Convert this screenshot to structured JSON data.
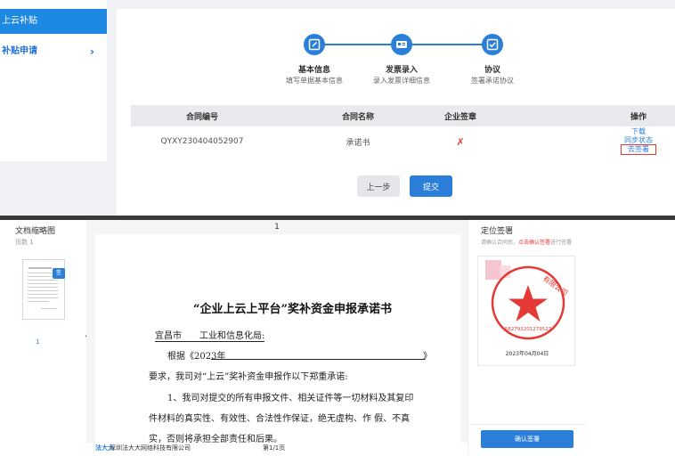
{
  "sidebar": {
    "active_item": "上云补贴",
    "item2": "补贴申请"
  },
  "steps": [
    {
      "title": "基本信息",
      "subtitle": "填写单据基本信息"
    },
    {
      "title": "发票录入",
      "subtitle": "录入发票详细信息"
    },
    {
      "title": "协议",
      "subtitle": "签署承诺协议"
    }
  ],
  "table": {
    "headers": [
      "合同编号",
      "合同名称",
      "企业签章",
      "操作"
    ],
    "row": {
      "contract_no": "QYXY230404052907",
      "contract_name": "承诺书",
      "seal_status": "✗",
      "actions": [
        "下载",
        "同步状态",
        "去签署"
      ]
    }
  },
  "buttons": {
    "prev": "上一步",
    "submit": "提交"
  },
  "viewer": {
    "left_title": "文档缩略图",
    "page_count": "页数 1",
    "thumb_badge": "签",
    "thumb_page": "1",
    "current_page": "1",
    "doc_title": "“企业上云上平台”奖补资金申报承诺书",
    "lines": [
      "宜昌市　　工业和信息化局:",
      "根据《2023年",
      "》",
      "要求，我司对“上云”奖补资金申报作以下郑重承诺:",
      "1、我司对提交的所有申报文件、相关证件等一切材料及其复印",
      "件材料的真实性、有效性、合法性作保证，绝无虚构、作 假、不真",
      "实，否则将承担全部责任和后果。"
    ],
    "footer_logo": "法大大",
    "footer_company": "深圳法大大网络科技有限公司",
    "footer_page": "第1/1页",
    "right_title": "定位签署",
    "hint_prefix": "请确认合同后，",
    "hint_red": "点击确认签署",
    "hint_suffix": "进行签署",
    "seal_text": "有限公司",
    "seal_code": "582793201279527",
    "seal_date": "2023年04月04日",
    "confirm_btn": "确认签署"
  },
  "colors": {
    "primary": "#2b7fd8",
    "danger": "#e53935",
    "seal": "#e53935"
  }
}
